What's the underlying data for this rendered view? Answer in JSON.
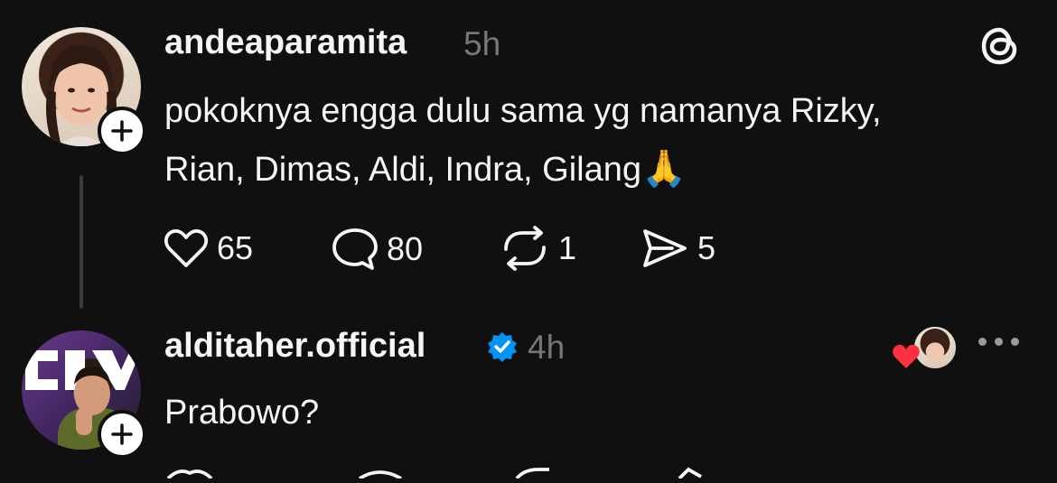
{
  "post": {
    "username": "andeaparamita",
    "time": "5h",
    "text_line1": "pokoknya engga dulu sama yg namanya Rizky,",
    "text_line2": "Rian, Dimas, Aldi, Indra, Gilang",
    "emoji": "🙏",
    "likes": "65",
    "replies": "80",
    "reposts": "1",
    "shares": "5"
  },
  "reply": {
    "username": "alditaher.official",
    "time": "4h",
    "text": "Prabowo?",
    "verified": true
  },
  "icons": {
    "threads_logo": "threads-logo-icon",
    "verified": "verified-badge-icon",
    "more": "more-options-icon",
    "heart": "heart-icon",
    "comment": "comment-icon",
    "repost": "repost-icon",
    "share": "send-icon",
    "follow": "plus-icon"
  },
  "colors": {
    "background": "#101010",
    "text": "#f3f5f7",
    "muted": "#777777",
    "verified": "#0095f6",
    "like_red": "#ff3040"
  }
}
